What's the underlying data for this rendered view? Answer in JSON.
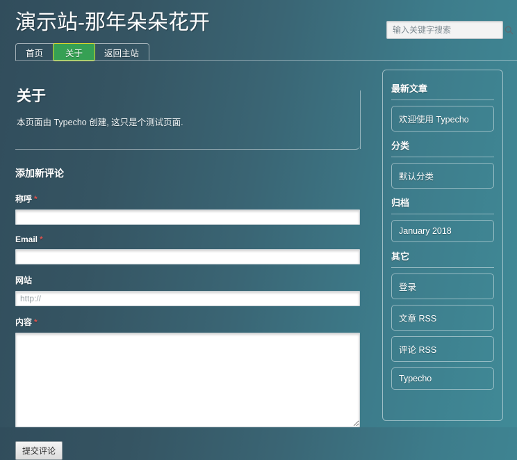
{
  "header": {
    "site_title": "演示站-那年朵朵花开",
    "nav": [
      {
        "label": "首页",
        "active": false
      },
      {
        "label": "关于",
        "active": true
      },
      {
        "label": "返回主站",
        "active": false
      }
    ],
    "search": {
      "placeholder": "输入关键字搜索",
      "value": "",
      "icon": "search-icon"
    }
  },
  "post": {
    "title": "关于",
    "body": "本页面由 Typecho 创建, 这只是个测试页面."
  },
  "comment_form": {
    "heading": "添加新评论",
    "required_mark": "*",
    "fields": [
      {
        "label": "称呼",
        "required": true,
        "value": "",
        "placeholder": ""
      },
      {
        "label": "Email",
        "required": true,
        "value": "",
        "placeholder": ""
      },
      {
        "label": "网站",
        "required": false,
        "value": "",
        "placeholder": "http://"
      },
      {
        "label": "内容",
        "required": true,
        "value": "",
        "placeholder": ""
      }
    ],
    "submit_label": "提交评论"
  },
  "sidebar": {
    "sections": [
      {
        "heading": "最新文章",
        "items": [
          "欢迎使用 Typecho"
        ]
      },
      {
        "heading": "分类",
        "items": [
          "默认分类"
        ]
      },
      {
        "heading": "归档",
        "items": [
          "January 2018"
        ]
      },
      {
        "heading": "其它",
        "items": [
          "登录",
          "文章 RSS",
          "评论 RSS",
          "Typecho"
        ]
      }
    ]
  },
  "colors": {
    "bg_left": "#314d5c",
    "bg_right": "#408a97",
    "active_tab_bg": "#36a054",
    "active_tab_border": "#d7d62e",
    "required_asterisk": "#d9534f",
    "input_bg": "#ffffff",
    "text": "#ffffff"
  }
}
